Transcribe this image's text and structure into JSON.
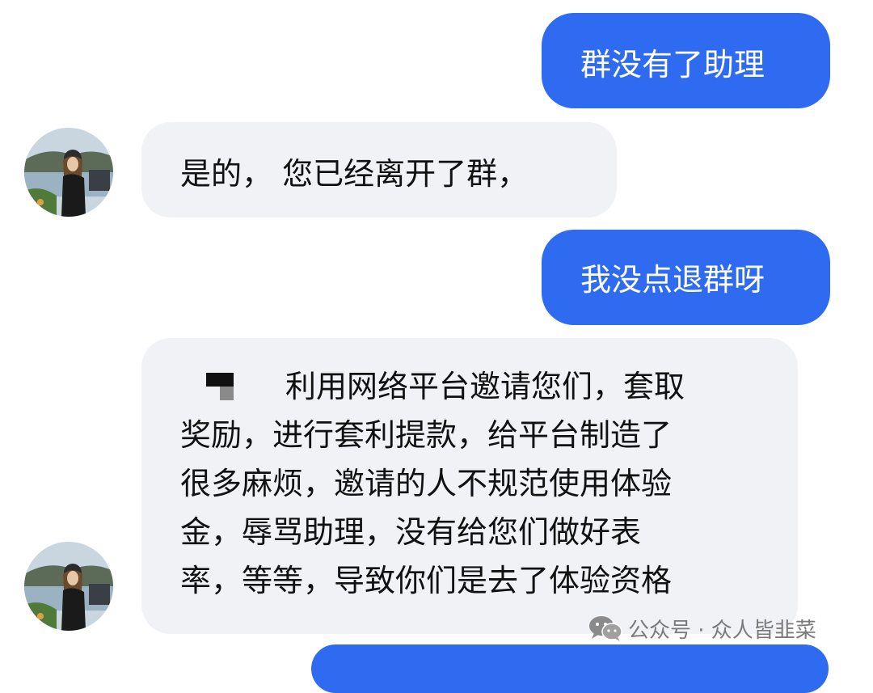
{
  "messages": {
    "m1": "群没有了助理",
    "m2": "是的， 您已经离开了群，",
    "m3": "我没点退群呀",
    "m4": {
      "line1": "利用网络平台邀请您们，套取",
      "line2": "奖励，进行套利提款，给平台制造了",
      "line3": "很多麻烦，邀请的人不规范使用体验",
      "line4": "金，辱骂助理，没有给您们做好表",
      "line5": "率，等等，导致你们是去了体验资格"
    }
  },
  "watermark": {
    "text": "公众号 · 众人皆韭菜",
    "icon": "wechat-icon"
  },
  "colors": {
    "outgoing_bubble": "#2f6bf0",
    "incoming_bubble": "#f1f2f6",
    "background": "#ffffff"
  },
  "icons": {
    "avatar": "avatar-photo",
    "redaction": "redacted-name-block"
  }
}
